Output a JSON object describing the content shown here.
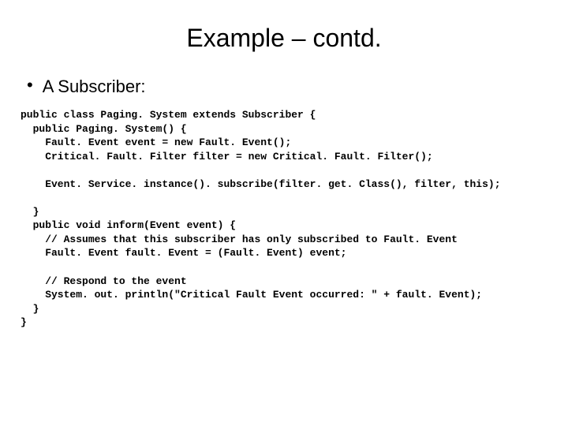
{
  "title": "Example – contd.",
  "bullet": "A Subscriber:",
  "code": "public class Paging. System extends Subscriber {\n  public Paging. System() {\n    Fault. Event event = new Fault. Event();\n    Critical. Fault. Filter filter = new Critical. Fault. Filter();\n\n    Event. Service. instance(). subscribe(filter. get. Class(), filter, this);\n\n  }\n  public void inform(Event event) {\n    // Assumes that this subscriber has only subscribed to Fault. Event\n    Fault. Event fault. Event = (Fault. Event) event;\n\n    // Respond to the event\n    System. out. println(\"Critical Fault Event occurred: \" + fault. Event);\n  }\n}"
}
